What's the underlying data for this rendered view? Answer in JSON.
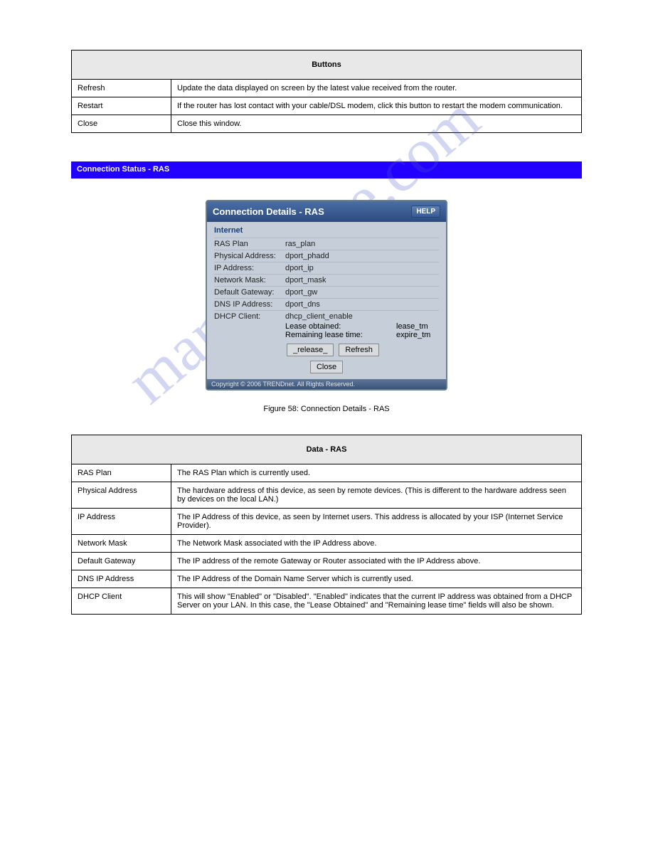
{
  "table1": {
    "header": "Buttons",
    "rows": [
      {
        "label": "Refresh",
        "desc": "Update the data displayed on screen by the latest value received from the router."
      },
      {
        "label": "Restart",
        "desc": "If the router has lost contact with your cable/DSL modem, click this button to restart the modem communication."
      },
      {
        "label": "Close",
        "desc": "Close this window."
      }
    ]
  },
  "bluebar": "Connection Status - RAS",
  "panel": {
    "title": "Connection Details - RAS",
    "help": "HELP",
    "section": "Internet",
    "rows": [
      {
        "label": "RAS Plan",
        "val": "ras_plan"
      },
      {
        "label": "Physical Address:",
        "val": "dport_phadd"
      },
      {
        "label": "IP Address:",
        "val": "dport_ip"
      },
      {
        "label": "Network Mask:",
        "val": "dport_mask"
      },
      {
        "label": "Default Gateway:",
        "val": "dport_gw"
      },
      {
        "label": "DNS IP Address:",
        "val": "dport_dns"
      },
      {
        "label": "DHCP Client:",
        "val": "dhcp_client_enable"
      }
    ],
    "sub": [
      {
        "k": "Lease obtained:",
        "v": "lease_tm"
      },
      {
        "k": "Remaining lease time:",
        "v": "expire_tm"
      }
    ],
    "btn_release": "_release_",
    "btn_refresh": "Refresh",
    "btn_close": "Close",
    "copyright": "Copyright © 2006 TRENDnet. All Rights Reserved."
  },
  "caption": "Figure 58: Connection Details - RAS",
  "table2": {
    "header": "Data - RAS",
    "rows": [
      {
        "label": "RAS Plan",
        "desc": "The RAS Plan which is currently used."
      },
      {
        "label": "Physical Address",
        "desc": "The hardware address of this device, as seen by remote devices. (This is different to the hardware address seen by devices on the local LAN.)"
      },
      {
        "label": "IP Address",
        "desc": "The IP Address of this device, as seen by Internet users. This address is allocated by your ISP (Internet Service Provider)."
      },
      {
        "label": "Network Mask",
        "desc": "The Network Mask associated with the IP Address above."
      },
      {
        "label": "Default Gateway",
        "desc": "The IP address of the remote Gateway or Router associated with the IP Address above."
      },
      {
        "label": "DNS IP Address",
        "desc": "The IP Address of the Domain Name Server which is currently used."
      },
      {
        "label": "DHCP Client",
        "desc": "This will show \"Enabled\" or \"Disabled\". \"Enabled\" indicates that the current IP address was obtained from a DHCP Server on your LAN. In this case, the \"Lease Obtained\" and \"Remaining lease time\" fields will also be shown."
      }
    ]
  },
  "watermark": "manualslive.com"
}
